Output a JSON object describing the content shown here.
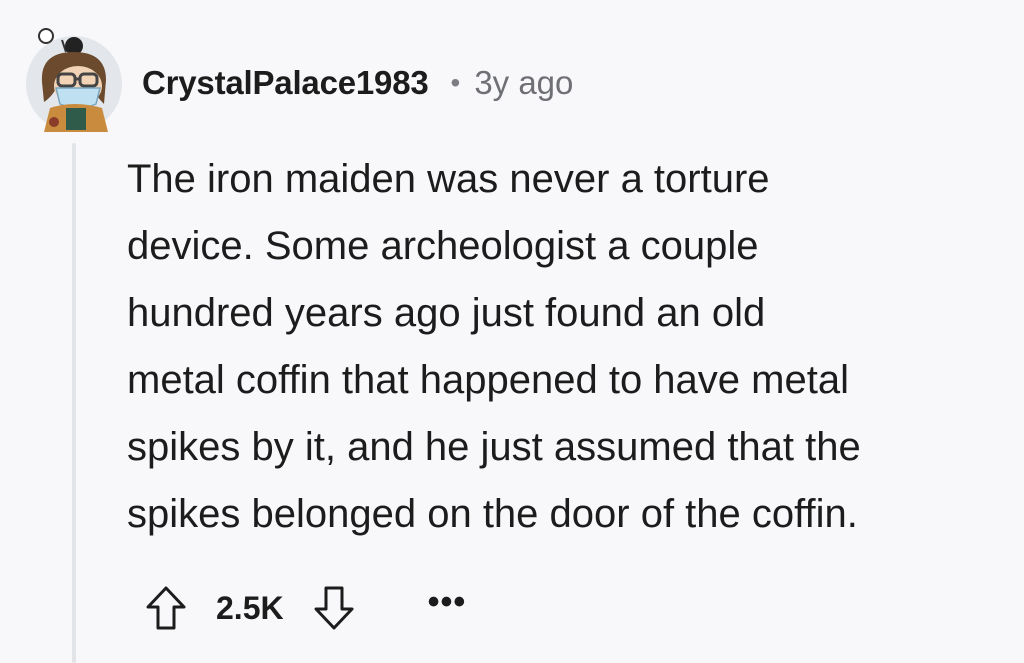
{
  "comment": {
    "username": "CrystalPalace1983",
    "separator": "•",
    "timestamp": "3y ago",
    "body_lines": [
      "The iron maiden was never a torture",
      "device. Some archeologist a couple",
      "hundred years ago just found an old",
      "metal coffin that happened to have metal",
      "spikes by it, and he just assumed that the",
      "spikes belonged on the door of the coffin."
    ],
    "score": "2.5K",
    "more_label": "•••"
  },
  "icons": {
    "upvote": "upvote-arrow-icon",
    "downvote": "downvote-arrow-icon",
    "more": "more-options-icon",
    "avatar": "user-avatar"
  },
  "colors": {
    "background": "#f8f8fa",
    "thread_line": "#e2e4e7",
    "text": "#1c1c1c",
    "muted": "#6f7075"
  }
}
